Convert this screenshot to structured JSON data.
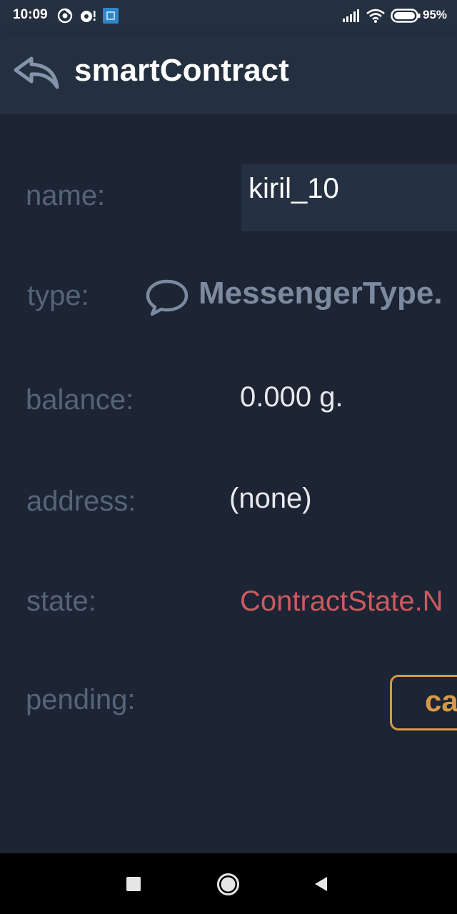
{
  "status_bar": {
    "time": "10:09",
    "battery_percent": "95%",
    "icons": [
      "chrome-icon",
      "notification-icon",
      "app-icon",
      "signal-icon",
      "wifi-icon",
      "battery-icon"
    ]
  },
  "app_bar": {
    "title": "smartContract",
    "back_icon": "back-arrow-icon"
  },
  "fields": {
    "name_label": "name:",
    "name_value": "kiril_10",
    "type_label": "type:",
    "type_icon": "chat-bubble-icon",
    "type_value": "MessengerType.",
    "balance_label": "balance:",
    "balance_value": "0.000 g.",
    "address_label": "address:",
    "address_value": "(none)",
    "state_label": "state:",
    "state_value": "ContractState.N",
    "pending_label": "pending:",
    "cancel_label": "ca"
  },
  "colors": {
    "background": "#1d2433",
    "app_bar": "#243040",
    "label": "#566479",
    "value": "#e6e9ee",
    "state_error": "#cc5a60",
    "accent_orange": "#d49a48"
  },
  "nav_bar": {
    "icons": [
      "recents-square-icon",
      "home-circle-icon",
      "back-triangle-icon"
    ]
  }
}
